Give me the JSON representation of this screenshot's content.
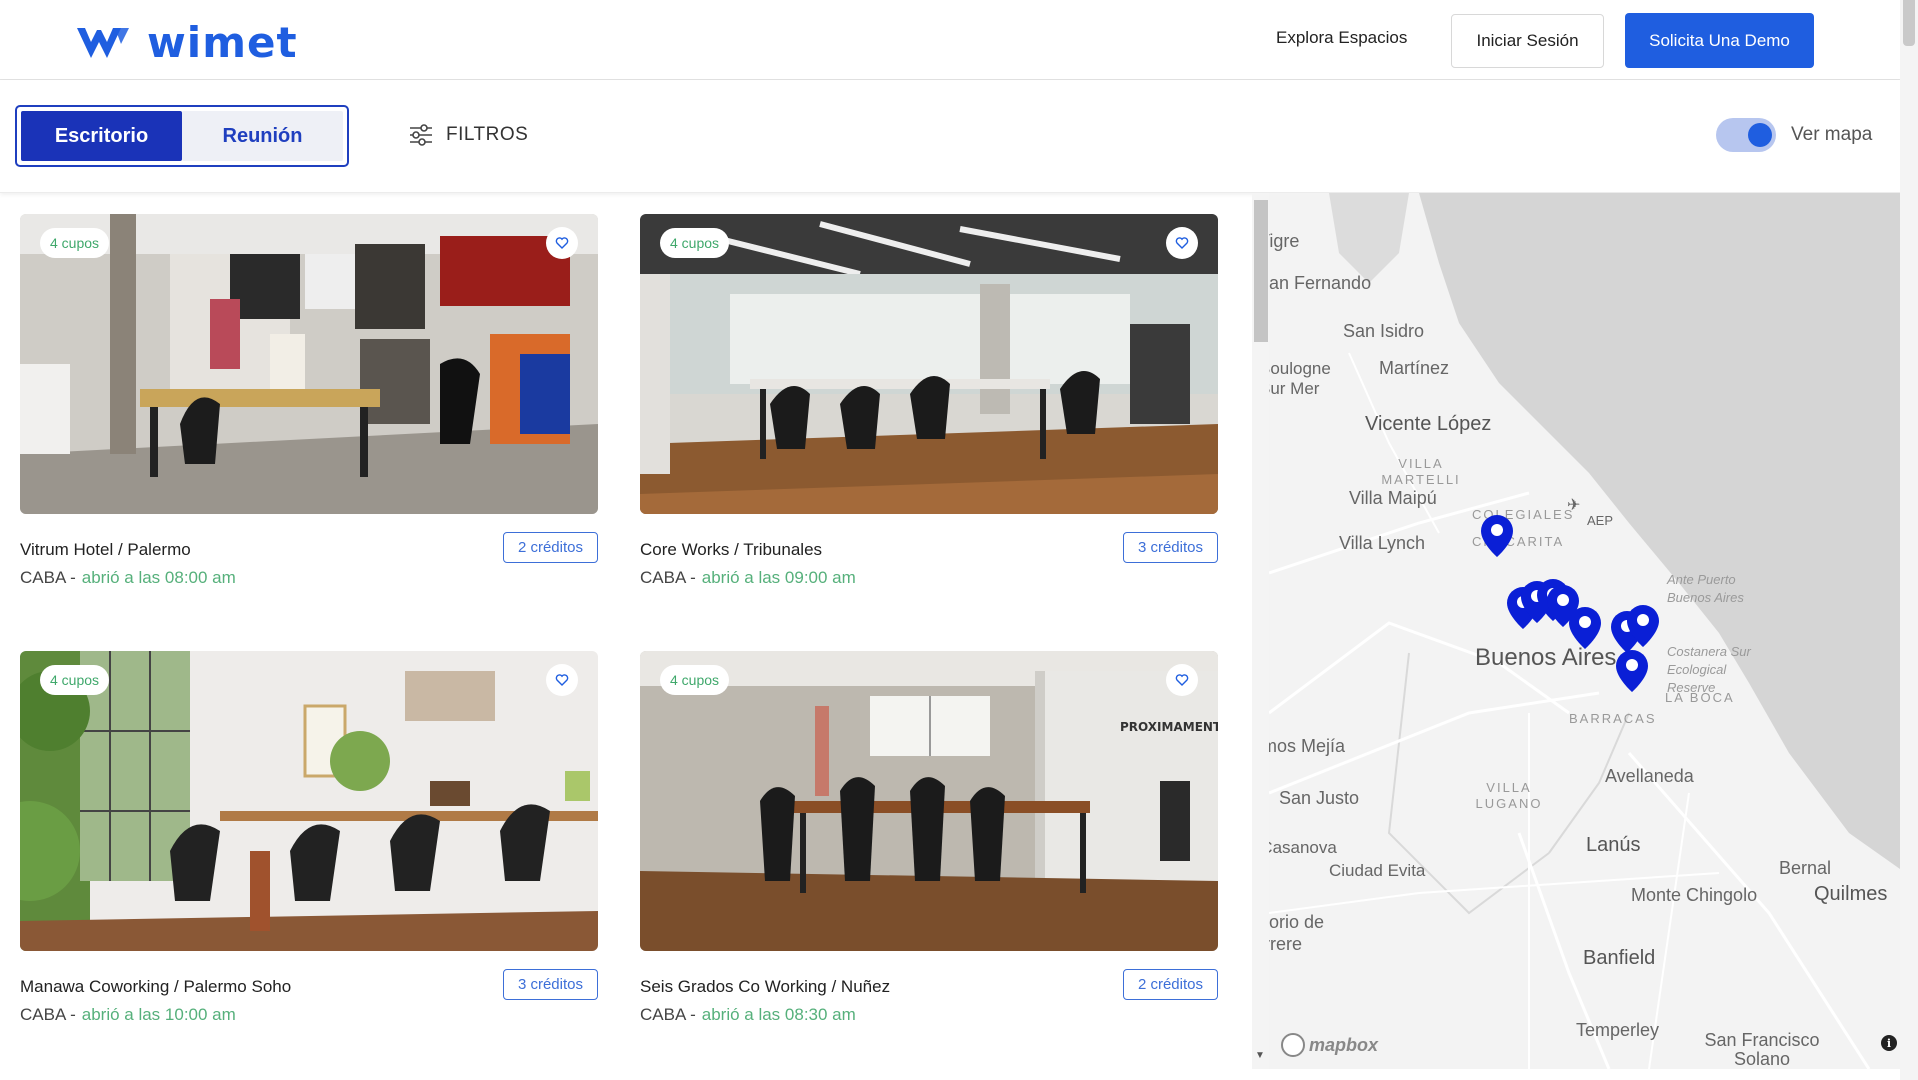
{
  "header": {
    "brand": "wimet",
    "nav_explore": "Explora Espacios",
    "login_label": "Iniciar Sesión",
    "demo_label": "Solicita Una Demo"
  },
  "filterbar": {
    "tabs": [
      {
        "label": "Escritorio",
        "active": true
      },
      {
        "label": "Reunión",
        "active": false
      }
    ],
    "filters_label": "FILTROS",
    "map_toggle_label": "Ver mapa",
    "map_toggle_on": true
  },
  "listings": [
    {
      "badge": "4 cupos",
      "title": "Vitrum Hotel / Palermo",
      "credits": "2 créditos",
      "city": "CABA -",
      "opening": "abrió a las 08:00 am"
    },
    {
      "badge": "4 cupos",
      "title": "Core Works / Tribunales",
      "credits": "3 créditos",
      "city": "CABA -",
      "opening": "abrió a las 09:00 am"
    },
    {
      "badge": "4 cupos",
      "title": "Manawa Coworking / Palermo Soho",
      "credits": "3 créditos",
      "city": "CABA -",
      "opening": "abrió a las 10:00 am"
    },
    {
      "badge": "4 cupos",
      "title": "Seis Grados Co Working / Nuñez",
      "credits": "2 créditos",
      "city": "CABA -",
      "opening": "abrió a las 08:30 am"
    }
  ],
  "photo_text": {
    "proximamente": "PROXIMAMENTE"
  },
  "map": {
    "labels": {
      "tigre": "Tigre",
      "san_fernando": "San Fernando",
      "san_isidro": "San Isidro",
      "boulogne": "Boulogne Sur Mer",
      "martinez": "Martínez",
      "vicente_lopez": "Vicente López",
      "villa_martelli": "VILLA MARTELLI",
      "villa_maipu": "Villa Maipú",
      "colegiales": "COLEGIALES",
      "chacarita": "CHACARITA",
      "aep": "AEP",
      "ante_puerto": "Ante Puerto Buenos Aires",
      "villa_lynch": "Villa Lynch",
      "buenos_aires": "Buenos Aires",
      "costanera": "Costanera Sur Ecological Reserve",
      "la_boca": "LA BOCA",
      "ramos_mejia": "Ramos Mejía",
      "barracas": "BARRACAS",
      "avellaneda": "Avellaneda",
      "san_justo": "San Justo",
      "villa_lugano": "VILLA LUGANO",
      "casanova": "Isidro Casanova",
      "lanus": "Lanús",
      "ciudad_evita": "Ciudad Evita",
      "bernal": "Bernal",
      "monte_chingolo": "Monte Chingolo",
      "quilmes": "Quilmes",
      "gregorio": "Gregorio de Laferrere",
      "banfield": "Banfield",
      "temperley": "Temperley",
      "san_francisco_solano": "San Francisco Solano"
    },
    "attribution": "mapbox",
    "pin_color": "#0a1fd6"
  },
  "icons": {
    "filters": "sliders-icon",
    "favorite": "heart-icon",
    "info": "info-icon",
    "pin": "map-pin-icon"
  },
  "colors": {
    "brand": "#1f5ee0",
    "tab_active": "#1a33b8",
    "badge_green": "#3fa86b",
    "open_green": "#56b07b"
  }
}
